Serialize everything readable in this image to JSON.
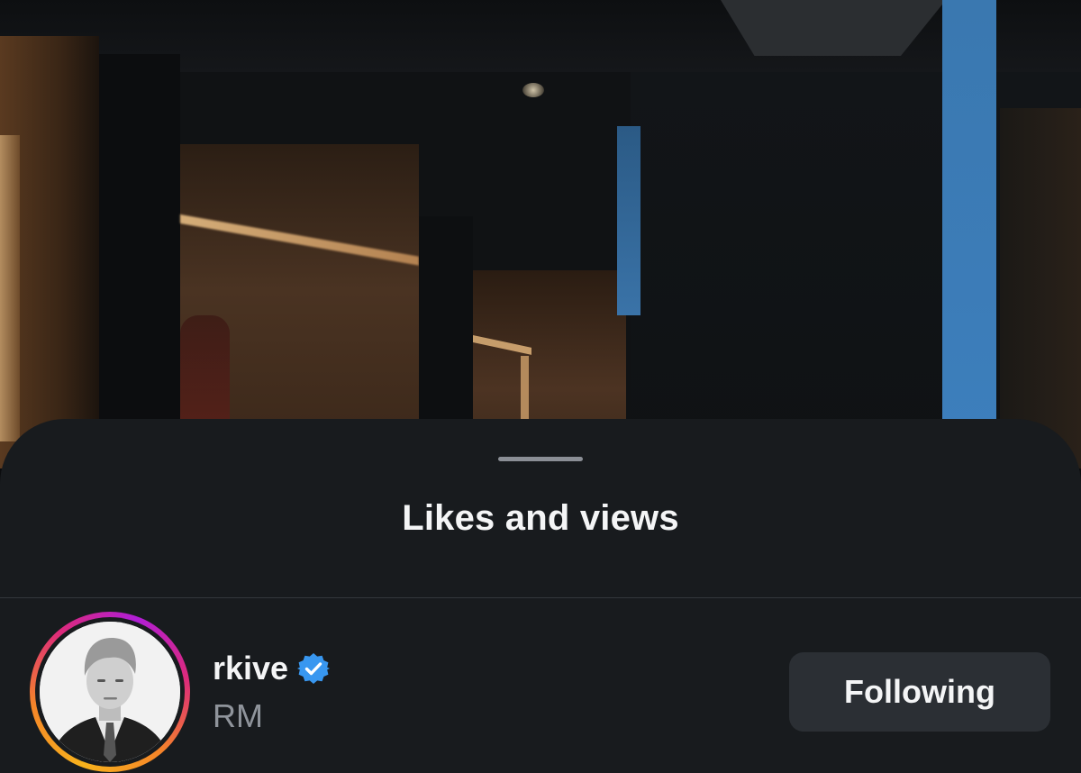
{
  "sheet": {
    "title": "Likes and views"
  },
  "user": {
    "username": "rkive",
    "full_name": "RM",
    "verified": true,
    "verified_icon": "verified-badge-icon",
    "avatar_icon": "profile-photo-avatar",
    "follow_button_label": "Following"
  },
  "colors": {
    "sheet_background": "#181b1e",
    "title_text": "#f4f5f6",
    "secondary_text": "#8f949b",
    "verified_blue": "#3897f0",
    "button_background": "#2b2f34",
    "story_ring_start": "#f7b21c",
    "story_ring_end": "#b01ed6"
  }
}
